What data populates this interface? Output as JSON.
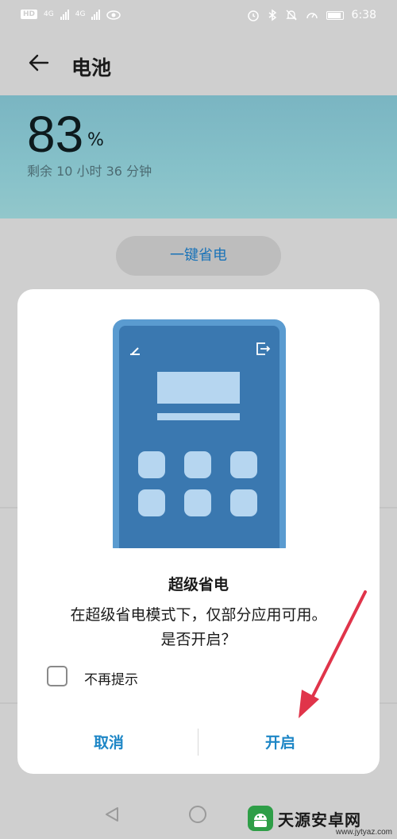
{
  "status_bar": {
    "hd_label": "HD",
    "net1": "4G",
    "net2": "4G",
    "time": "6:38"
  },
  "header": {
    "title": "电池"
  },
  "battery": {
    "percent": "83",
    "percent_sign": "%",
    "remaining": "剩余 10 小时 36 分钟",
    "level": 0.83
  },
  "power_save_button": {
    "label": "一键省电"
  },
  "dialog": {
    "title": "超级省电",
    "message_line1": "在超级省电模式下，仅部分应用可用。",
    "message_line2": "是否开启？",
    "checkbox_label": "不再提示",
    "checkbox_checked": false,
    "cancel_label": "取消",
    "confirm_label": "开启"
  },
  "watermark": {
    "text": "天源安卓网",
    "url": "www.jytyaz.com"
  },
  "colors": {
    "accent": "#1d86c6",
    "annotation_arrow": "#e0344a",
    "phone_illustration": "#3a78b0"
  }
}
